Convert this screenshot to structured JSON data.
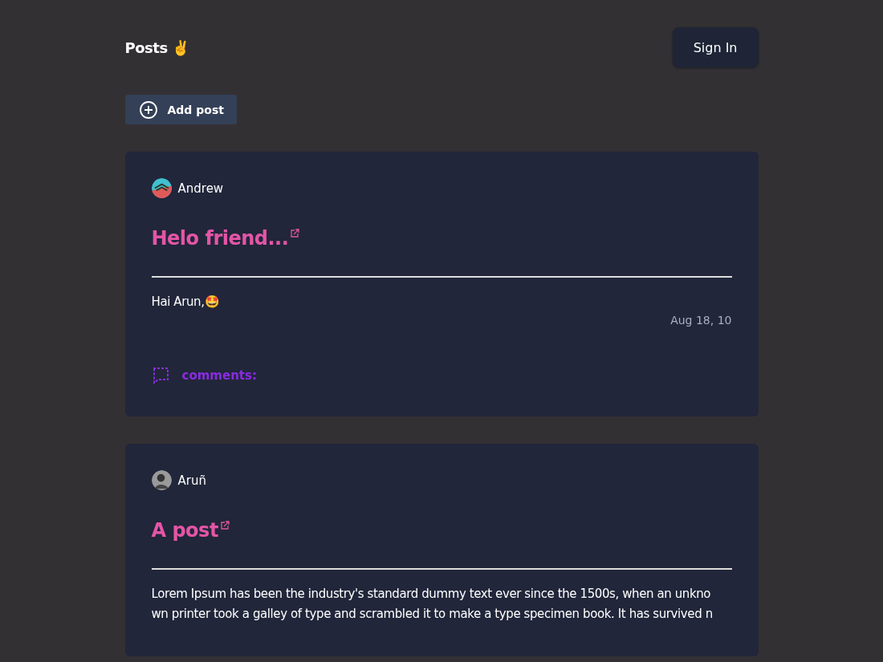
{
  "header": {
    "title": "Posts ✌️",
    "sign_in": "Sign In"
  },
  "add_post": "Add post",
  "posts": [
    {
      "author": "Andrew",
      "avatar": {
        "kind": "artwork"
      },
      "title": "Helo friend...",
      "body_lines": [
        "Hai Arun,🤩"
      ],
      "date": "Aug 18, 10",
      "comments_label": "comments:"
    },
    {
      "author": "Aruñ",
      "avatar": {
        "kind": "photo"
      },
      "title": "A post",
      "body_lines": [
        "Lorem Ipsum has been the industry's standard dummy text ever since the 1500s, when an unkno",
        "wn printer took a galley of type and scrambled it to make a type specimen book. It has survived n"
      ]
    }
  ]
}
